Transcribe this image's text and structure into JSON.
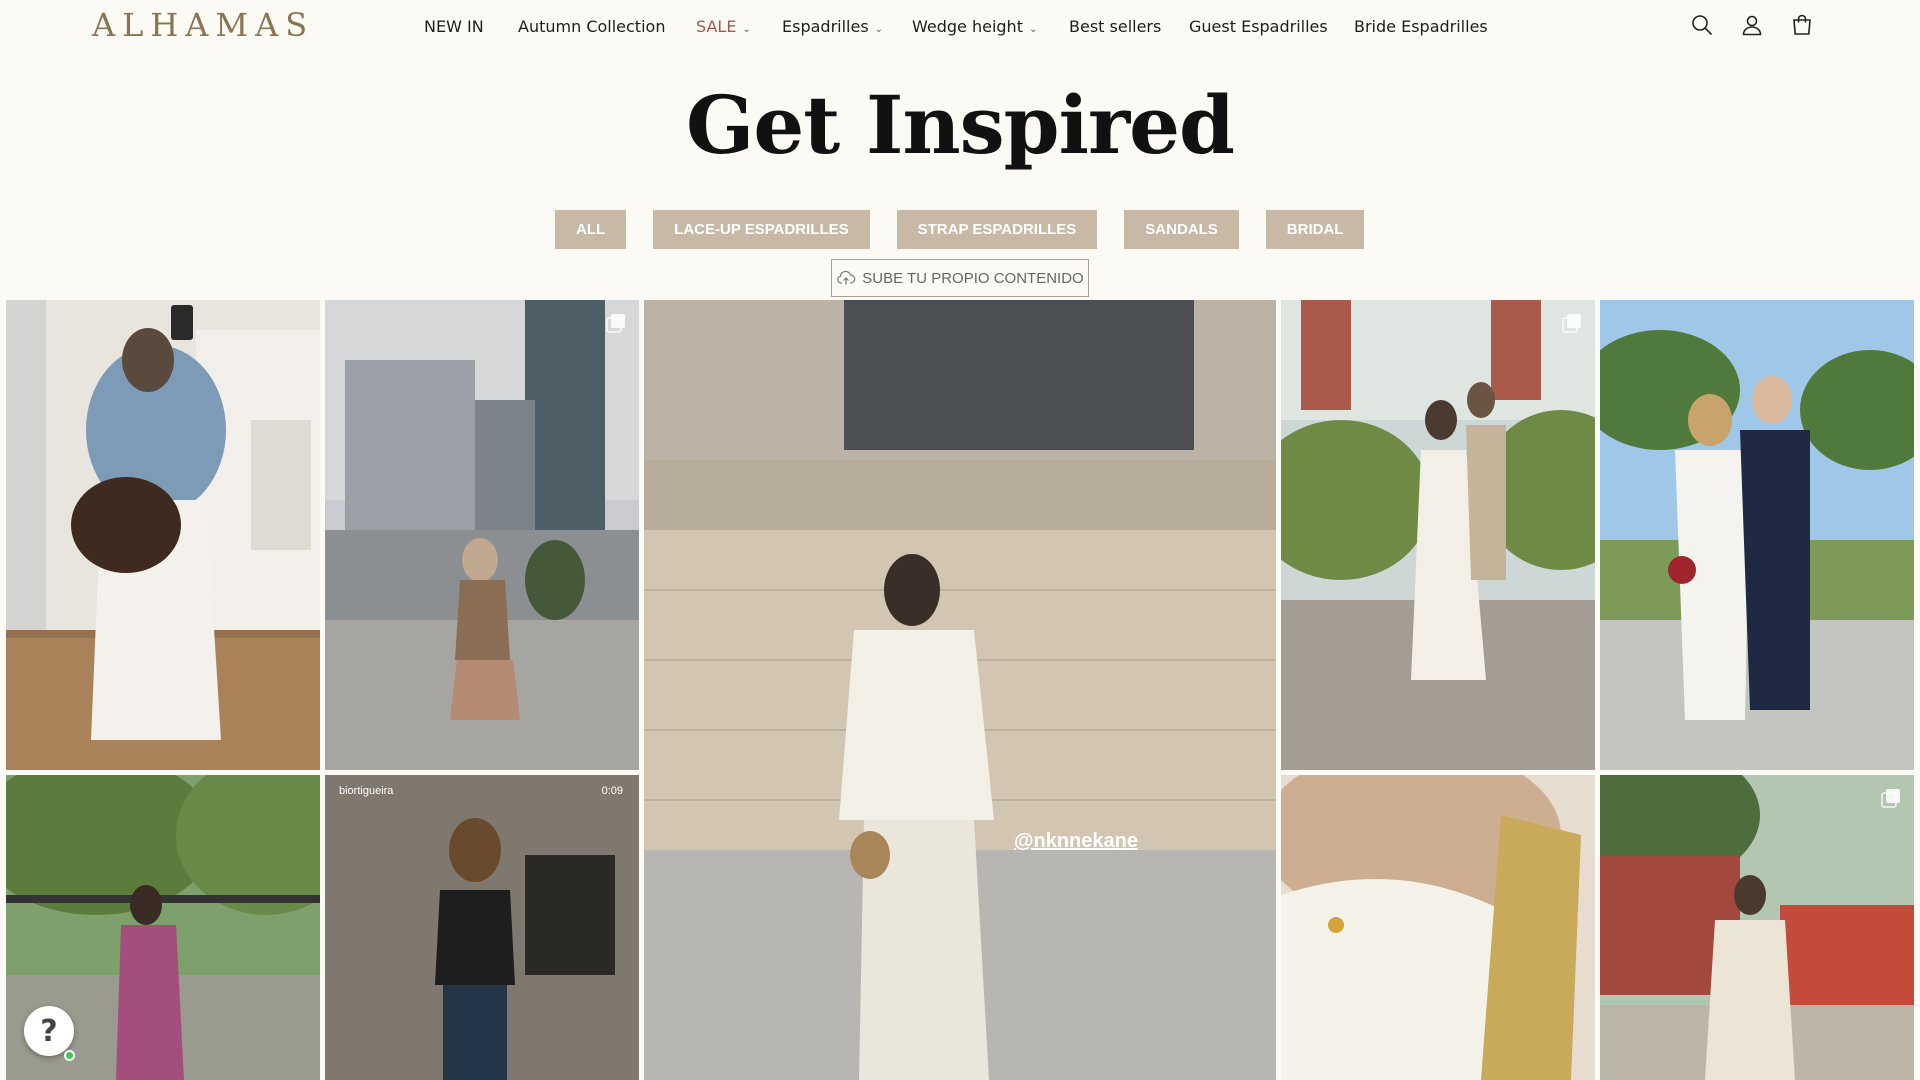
{
  "header": {
    "logo": "ALHAMAS",
    "nav": [
      {
        "label": "NEW IN",
        "dropdown": false
      },
      {
        "label": "Autumn Collection",
        "dropdown": false
      },
      {
        "label": "SALE",
        "dropdown": true
      },
      {
        "label": "Espadrilles",
        "dropdown": true
      },
      {
        "label": "Wedge height",
        "dropdown": true
      },
      {
        "label": "Best sellers",
        "dropdown": false
      },
      {
        "label": "Guest Espadrilles",
        "dropdown": false
      },
      {
        "label": "Bride Espadrilles",
        "dropdown": false
      }
    ],
    "icons": [
      "search-icon",
      "account-icon",
      "cart-icon"
    ]
  },
  "page": {
    "title": "Get Inspired"
  },
  "filters": [
    "ALL",
    "LACE-UP ESPADRILLES",
    "STRAP ESPADRILLES",
    "SANDALS",
    "BRIDAL"
  ],
  "upload": {
    "label": "SUBE TU PROPIO CONTENIDO",
    "icon": "cloud-upload-icon"
  },
  "gallery": {
    "featured_handle": "@nknnekane",
    "video_user": "biortigueira",
    "video_duration": "0:09"
  },
  "colors": {
    "background": "#fcfaf5",
    "filter_button": "#c8b8a6",
    "logo": "#8a7552",
    "sale": "#a0584e"
  }
}
